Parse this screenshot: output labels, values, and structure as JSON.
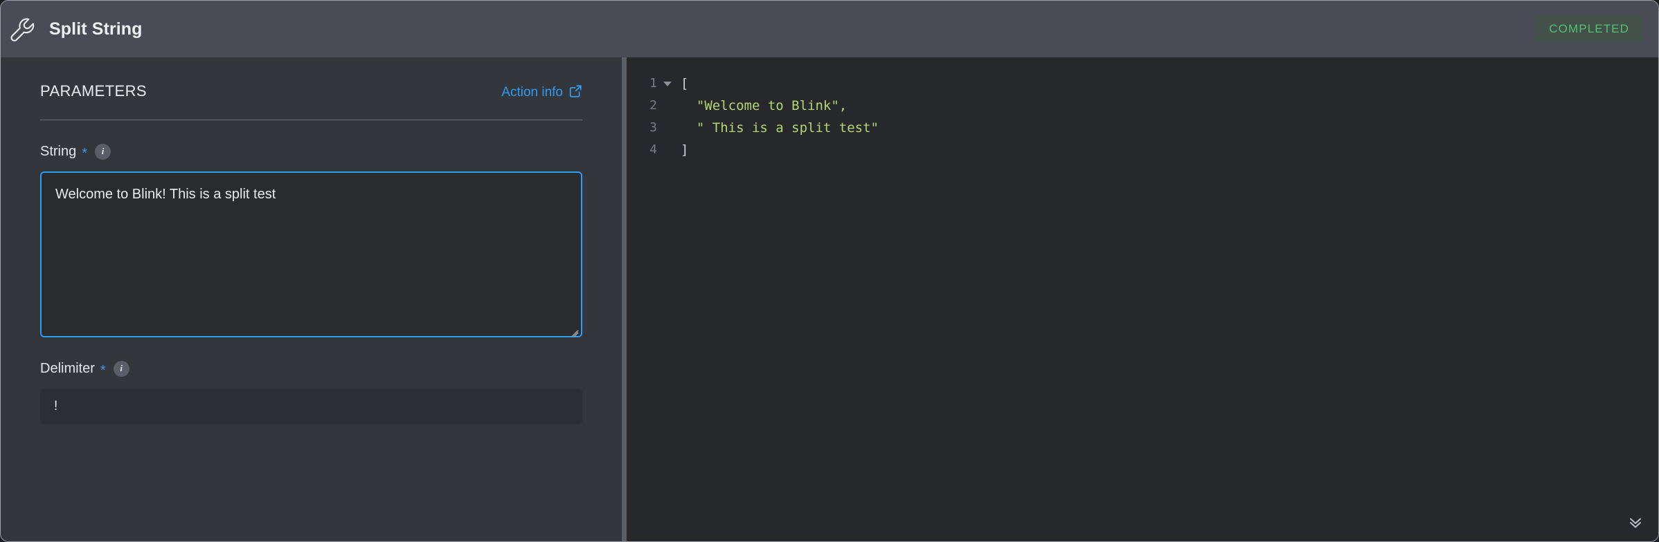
{
  "header": {
    "icon": "wrench-icon",
    "title": "Split String",
    "status_badge": "COMPLETED",
    "badge_color": "#4fc36a",
    "badge_bg": "#44504a",
    "background": "#4a4c55"
  },
  "left_panel": {
    "section_title": "PARAMETERS",
    "action_info_label": "Action info",
    "action_info_icon": "external-link-icon",
    "accent_color": "#2f9cf4",
    "fields": [
      {
        "label": "String",
        "required_marker": "*",
        "info_icon": "info-icon",
        "type": "textarea",
        "value": "Welcome to Blink! This is a split test",
        "placeholder": "",
        "focused": true
      },
      {
        "label": "Delimiter",
        "required_marker": "*",
        "info_icon": "info-icon",
        "type": "input",
        "value": "!",
        "placeholder": "",
        "focused": false
      }
    ]
  },
  "right_panel": {
    "language": "json",
    "fold_icon": "chevron-down-triangle-icon",
    "collapse_icon": "double-chevron-down-icon",
    "string_color": "#b5d66f",
    "punctuation_color": "#cfd3d8",
    "lines": [
      {
        "number": "1",
        "foldable": true,
        "indent": "",
        "text": "[",
        "kind": "punc"
      },
      {
        "number": "2",
        "foldable": false,
        "indent": "  ",
        "text": "\"Welcome to Blink\",",
        "kind": "str"
      },
      {
        "number": "3",
        "foldable": false,
        "indent": "  ",
        "text": "\" This is a split test\"",
        "kind": "str"
      },
      {
        "number": "4",
        "foldable": false,
        "indent": "",
        "text": "]",
        "kind": "punc"
      }
    ],
    "result": [
      "Welcome to Blink",
      " This is a split test"
    ]
  }
}
